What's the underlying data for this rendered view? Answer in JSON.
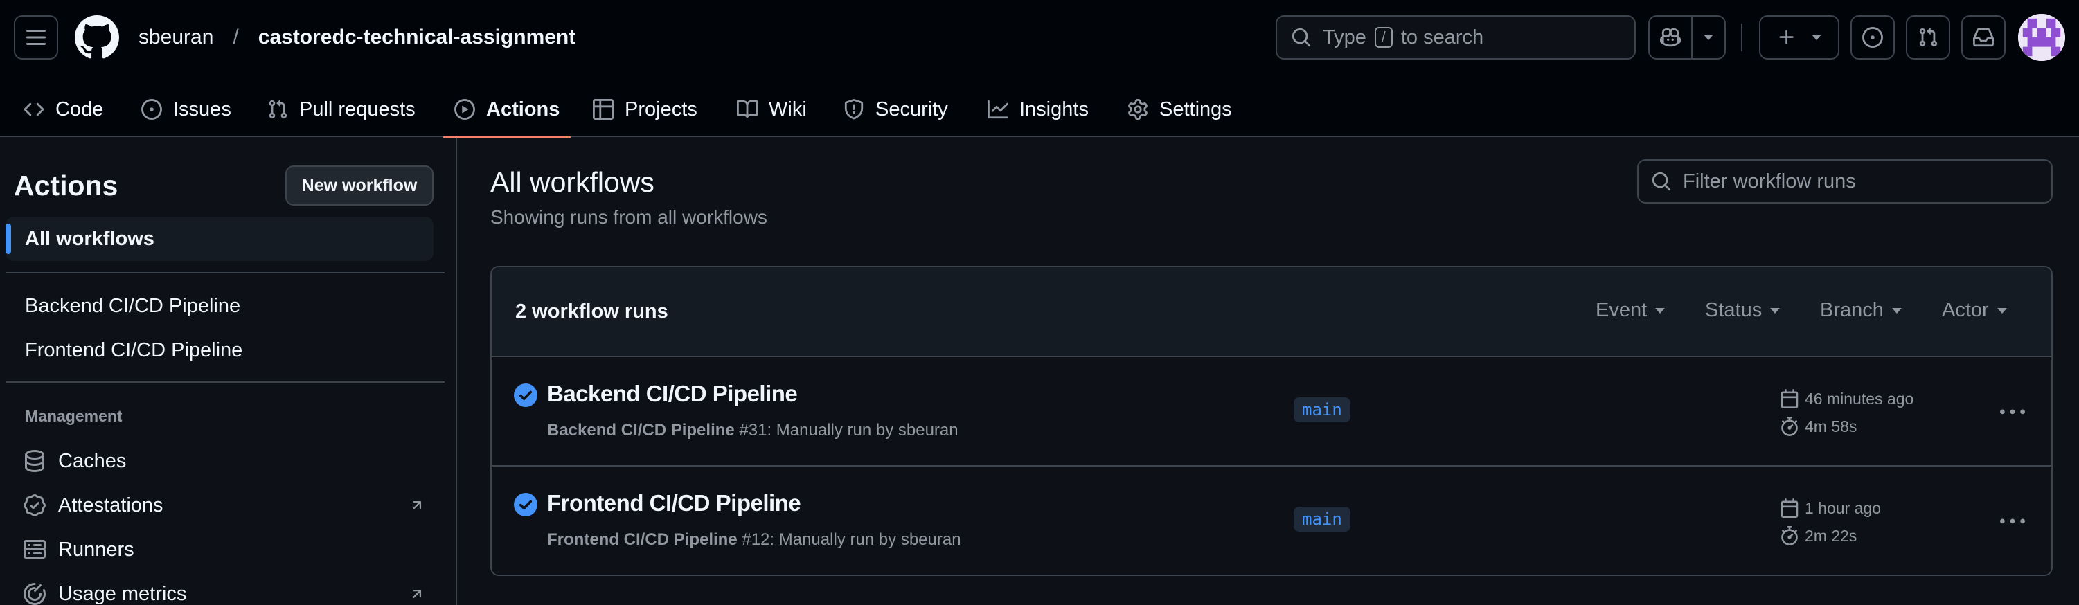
{
  "header": {
    "owner": "sbeuran",
    "separator": "/",
    "repo": "castoredc-technical-assignment",
    "search": {
      "prefix": "Type",
      "key": "/",
      "suffix": "to search"
    }
  },
  "repo_nav": [
    {
      "label": "Code",
      "icon": "code-icon"
    },
    {
      "label": "Issues",
      "icon": "issue-opened-icon"
    },
    {
      "label": "Pull requests",
      "icon": "git-pull-request-icon"
    },
    {
      "label": "Actions",
      "icon": "play-icon",
      "active": true
    },
    {
      "label": "Projects",
      "icon": "table-icon"
    },
    {
      "label": "Wiki",
      "icon": "book-icon"
    },
    {
      "label": "Security",
      "icon": "shield-icon"
    },
    {
      "label": "Insights",
      "icon": "graph-icon"
    },
    {
      "label": "Settings",
      "icon": "gear-icon"
    }
  ],
  "sidebar": {
    "title": "Actions",
    "new_workflow": "New workflow",
    "all_workflows": "All workflows",
    "workflows": [
      "Backend CI/CD Pipeline",
      "Frontend CI/CD Pipeline"
    ],
    "management_heading": "Management",
    "management": [
      {
        "label": "Caches",
        "icon": "database-icon",
        "external": false
      },
      {
        "label": "Attestations",
        "icon": "verified-icon",
        "external": true
      },
      {
        "label": "Runners",
        "icon": "server-icon",
        "external": false
      },
      {
        "label": "Usage metrics",
        "icon": "meter-icon",
        "external": true
      }
    ]
  },
  "main": {
    "title": "All workflows",
    "subtitle": "Showing runs from all workflows",
    "filter_placeholder": "Filter workflow runs",
    "runs_count": "2 workflow runs",
    "filters": [
      "Event",
      "Status",
      "Branch",
      "Actor"
    ],
    "runs": [
      {
        "title": "Backend CI/CD Pipeline",
        "workflow": "Backend CI/CD Pipeline",
        "run_info": " #31: Manually run by sbeuran",
        "branch": "main",
        "when": "46 minutes ago",
        "duration": "4m 58s",
        "status": "success"
      },
      {
        "title": "Frontend CI/CD Pipeline",
        "workflow": "Frontend CI/CD Pipeline",
        "run_info": " #12: Manually run by sbeuran",
        "branch": "main",
        "when": "1 hour ago",
        "duration": "2m 22s",
        "status": "success"
      }
    ]
  },
  "colors": {
    "background": "#0d1117",
    "header_bg": "#010409",
    "border": "#3d444d",
    "accent_underline": "#f78166",
    "link_blue": "#4493f8",
    "success_check": "#4493f8"
  }
}
